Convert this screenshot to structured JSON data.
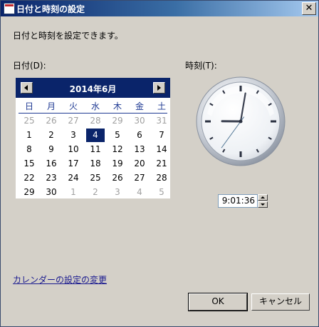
{
  "window": {
    "title": "日付と時刻の設定",
    "close_label": "✕"
  },
  "description": "日付と時刻を設定できます。",
  "date_label": "日付(D):",
  "time_label": "時刻(T):",
  "calendar": {
    "month_label": "2014年6月",
    "weekdays": [
      "日",
      "月",
      "火",
      "水",
      "木",
      "金",
      "土"
    ],
    "weeks": [
      [
        {
          "d": "25",
          "o": true
        },
        {
          "d": "26",
          "o": true
        },
        {
          "d": "27",
          "o": true
        },
        {
          "d": "28",
          "o": true
        },
        {
          "d": "29",
          "o": true
        },
        {
          "d": "30",
          "o": true
        },
        {
          "d": "31",
          "o": true
        }
      ],
      [
        {
          "d": "1"
        },
        {
          "d": "2"
        },
        {
          "d": "3"
        },
        {
          "d": "4",
          "s": true
        },
        {
          "d": "5"
        },
        {
          "d": "6"
        },
        {
          "d": "7"
        }
      ],
      [
        {
          "d": "8"
        },
        {
          "d": "9"
        },
        {
          "d": "10"
        },
        {
          "d": "11"
        },
        {
          "d": "12"
        },
        {
          "d": "13"
        },
        {
          "d": "14"
        }
      ],
      [
        {
          "d": "15"
        },
        {
          "d": "16"
        },
        {
          "d": "17"
        },
        {
          "d": "18"
        },
        {
          "d": "19"
        },
        {
          "d": "20"
        },
        {
          "d": "21"
        }
      ],
      [
        {
          "d": "22"
        },
        {
          "d": "23"
        },
        {
          "d": "24"
        },
        {
          "d": "25"
        },
        {
          "d": "26"
        },
        {
          "d": "27"
        },
        {
          "d": "28"
        }
      ],
      [
        {
          "d": "29"
        },
        {
          "d": "30"
        },
        {
          "d": "1",
          "o": true
        },
        {
          "d": "2",
          "o": true
        },
        {
          "d": "3",
          "o": true
        },
        {
          "d": "4",
          "o": true
        },
        {
          "d": "5",
          "o": true
        }
      ]
    ],
    "colors": {
      "header": "#0a246a",
      "selected": "#0a246a",
      "weekday": "#1f3a93",
      "other_month": "#a0a0a0"
    }
  },
  "clock": {
    "hours": 9,
    "minutes": 1,
    "seconds": 36
  },
  "time_value": "9:01:36",
  "change_calendar_link": "カレンダーの設定の変更",
  "buttons": {
    "ok": "OK",
    "cancel": "キャンセル"
  }
}
